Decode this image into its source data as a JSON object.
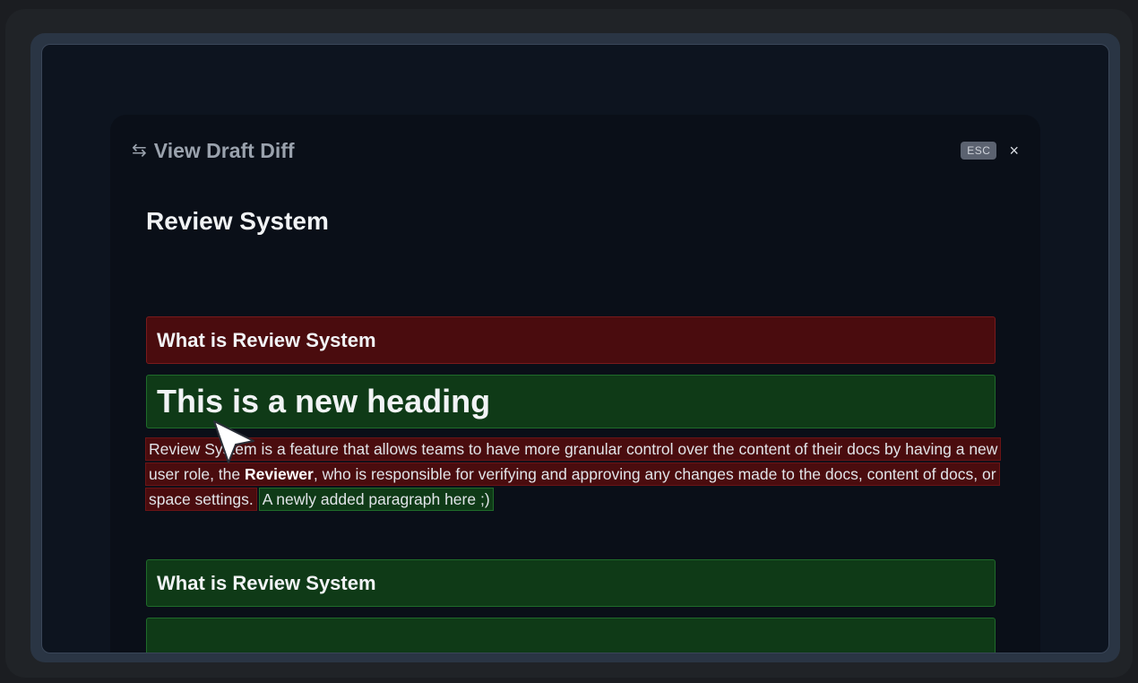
{
  "modal": {
    "title": "View Draft Diff",
    "icon": "swap-arrows-icon",
    "esc_label": "ESC",
    "close_label": "×"
  },
  "document": {
    "title": "Review System",
    "blocks": [
      {
        "kind": "removed",
        "type": "heading",
        "text": "What is Review System"
      },
      {
        "kind": "added",
        "type": "heading",
        "text": "This is a new heading"
      },
      {
        "kind": "added",
        "type": "heading",
        "text": "What is Review System"
      },
      {
        "kind": "added",
        "type": "block",
        "text": ""
      }
    ],
    "paragraph": {
      "removed_before": "Review System is a feature that allows teams to have more granular control over the content of their docs by having a new user role, the ",
      "removed_bold": "Reviewer",
      "removed_after": ", who is responsible for verifying and approving any changes made to the docs, content of docs, or space settings.",
      "added": "A newly added paragraph here ;)"
    }
  },
  "colors": {
    "removed_bg": "#4a0c0e",
    "added_bg": "#0f3a17",
    "background": "#0a0f18"
  }
}
